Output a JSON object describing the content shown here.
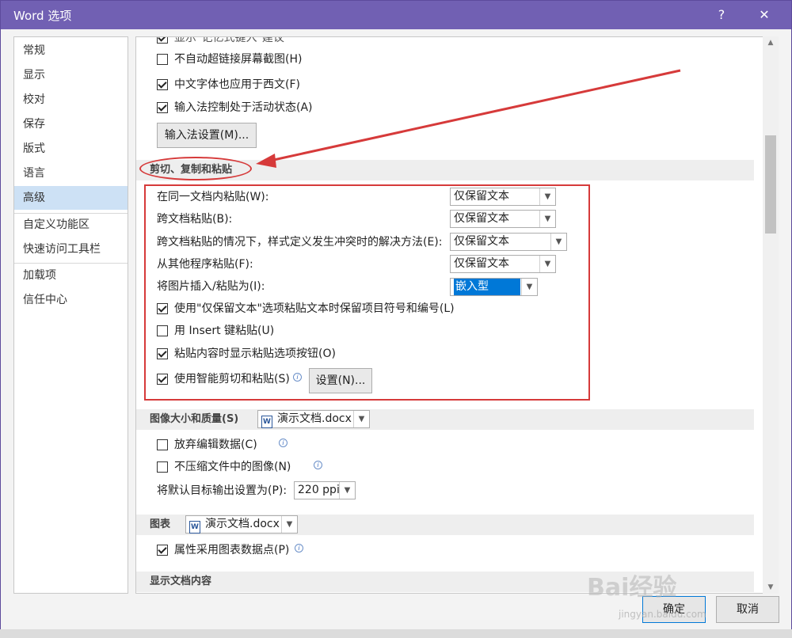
{
  "window": {
    "title": "Word 选项",
    "help": "?",
    "close": "✕"
  },
  "nav": {
    "items": [
      {
        "label": "常规"
      },
      {
        "label": "显示"
      },
      {
        "label": "校对"
      },
      {
        "label": "保存"
      },
      {
        "label": "版式"
      },
      {
        "label": "语言"
      },
      {
        "label": "高级",
        "active": true
      },
      {
        "label": "自定义功能区"
      },
      {
        "label": "快速访问工具栏"
      },
      {
        "label": "加载项"
      },
      {
        "label": "信任中心"
      }
    ]
  },
  "top_options": {
    "partial_label": "显示\"记忆式键入\"建议",
    "no_auto_hyperlink": {
      "label": "不自动超链接屏幕截图(H)",
      "checked": false
    },
    "chinese_font_western": {
      "label": "中文字体也应用于西文(F)",
      "checked": true
    },
    "ime_control": {
      "label": "输入法控制处于活动状态(A)",
      "checked": true
    },
    "ime_settings_button": "输入法设置(M)..."
  },
  "cut_copy_paste": {
    "header": "剪切、复制和粘贴",
    "rows": [
      {
        "label": "在同一文档内粘贴(W):",
        "value": "仅保留文本"
      },
      {
        "label": "跨文档粘贴(B):",
        "value": "仅保留文本"
      },
      {
        "label": "跨文档粘贴的情况下，样式定义发生冲突时的解决方法(E):",
        "value": "仅保留文本"
      },
      {
        "label": "从其他程序粘贴(F):",
        "value": "仅保留文本"
      },
      {
        "label": "将图片插入/粘贴为(I):",
        "value": "嵌入型"
      }
    ],
    "checks": [
      {
        "label": "使用\"仅保留文本\"选项粘贴文本时保留项目符号和编号(L)",
        "checked": true
      },
      {
        "label": "用 Insert 键粘贴(U)",
        "checked": false
      },
      {
        "label": "粘贴内容时显示粘贴选项按钮(O)",
        "checked": true
      },
      {
        "label": "使用智能剪切和粘贴(S)",
        "checked": true
      }
    ],
    "settings_button": "设置(N)..."
  },
  "image_size": {
    "header": "图像大小和质量(S)",
    "doc": "演示文档.docx",
    "discard_edit": {
      "label": "放弃编辑数据(C)",
      "checked": false
    },
    "no_compress": {
      "label": "不压缩文件中的图像(N)",
      "checked": false
    },
    "default_output_label": "将默认目标输出设置为(P):",
    "default_output_value": "220 ppi"
  },
  "chart": {
    "header": "图表",
    "doc": "演示文档.docx",
    "property_follow": {
      "label": "属性采用图表数据点(P)",
      "checked": true
    }
  },
  "show_doc_content": {
    "header": "显示文档内容"
  },
  "footer": {
    "ok": "确定",
    "cancel": "取消"
  },
  "watermark": {
    "brand": "Bai经验",
    "url": "jingyan.baidu.com"
  },
  "icons": {
    "info": "i",
    "doc": "W"
  },
  "colors": {
    "title_bar": "#7160b3",
    "annotation": "#d63a3a",
    "nav_active": "#cde1f5"
  }
}
